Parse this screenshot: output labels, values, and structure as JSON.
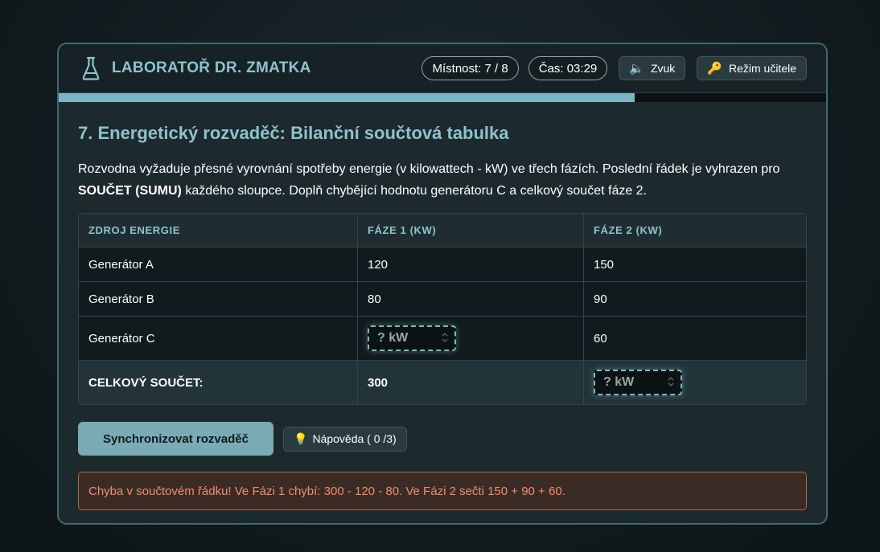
{
  "header": {
    "title": "LABORATOŘ DR. ZMATKA",
    "room": "Místnost: 7 / 8",
    "time": "Čas: 03:29",
    "sound_label": "Zvuk",
    "sound_glyph": "🔈",
    "teacher_label": "Režim učitele",
    "teacher_glyph": "🔑",
    "progress_fraction": 0.75,
    "accent_color": "#8ec3cc"
  },
  "puzzle": {
    "title": "7. Energetický rozvaděč: Bilanční součtová tabulka",
    "desc_part1": "Rozvodna vyžaduje přesné vyrovnání spotřeby energie (v kilowattech - kW) ve třech fázích. Poslední řádek je vyhrazen pro ",
    "desc_bold": "SOUČET (SUMU)",
    "desc_part2": " každého sloupce. Doplň chybějící hodnotu generátoru C a celkový součet fáze 2."
  },
  "table": {
    "headers": [
      "ZDROJ ENERGIE",
      "FÁZE 1 (KW)",
      "FÁZE 2 (KW)"
    ],
    "rows": [
      {
        "source": "Generátor A",
        "phase1": "120",
        "phase2": "150"
      },
      {
        "source": "Generátor B",
        "phase1": "80",
        "phase2": "90"
      },
      {
        "source": "Generátor C",
        "phase1": "",
        "phase2": "60"
      }
    ],
    "total": {
      "label": "CELKOVÝ SOUČET:",
      "phase1": "300",
      "phase2": ""
    },
    "input_placeholder": "? kW"
  },
  "actions": {
    "sync_label": "Synchronizovat rozvaděč",
    "hint_glyph": "💡",
    "hint_label": "Nápověda ( 0 /3)"
  },
  "error_message": "Chyba v součtovém řádku! Ve Fázi 1 chybí: 300 - 120 - 80. Ve Fázi 2 sečti 150 + 90 + 60."
}
